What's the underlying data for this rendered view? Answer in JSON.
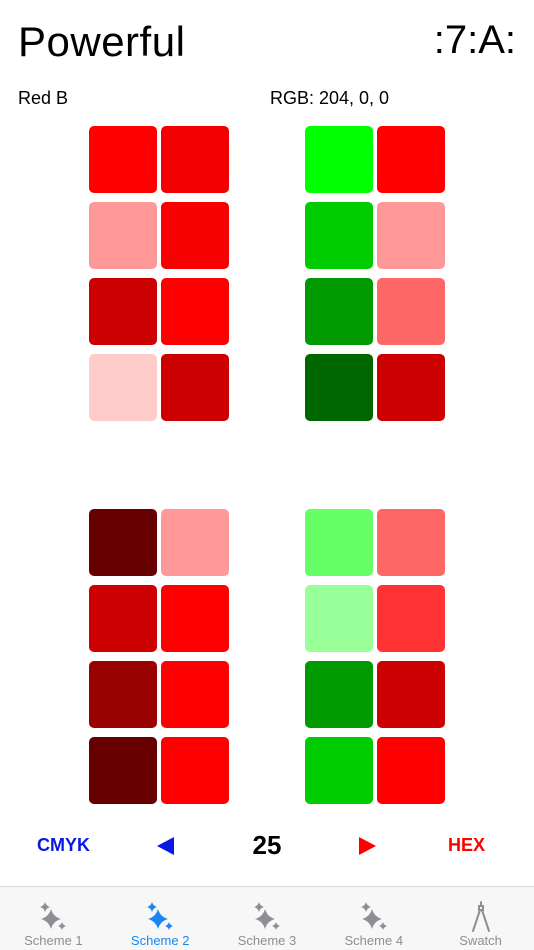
{
  "header": {
    "title": "Powerful",
    "logo": ":7:A:"
  },
  "info": {
    "color_name": "Red B",
    "rgb_text": "RGB: 204, 0, 0"
  },
  "palettes": {
    "top_left": [
      "#ff0000",
      "#f10002",
      "#ff9999",
      "#f60000",
      "#cc0000",
      "#ff0000",
      "#ffcccc",
      "#cc0000"
    ],
    "top_right": [
      "#00ff00",
      "#ff0000",
      "#00cc00",
      "#ff9999",
      "#009900",
      "#ff6666",
      "#006600",
      "#cc0000"
    ],
    "bottom_left": [
      "#660000",
      "#ff9999",
      "#cc0000",
      "#ff0000",
      "#990000",
      "#ff0000",
      "#660000",
      "#ff0000"
    ],
    "bottom_right": [
      "#66ff66",
      "#ff6666",
      "#99ff99",
      "#ff3333",
      "#009900",
      "#cc0000",
      "#00cc00",
      "#ff0000"
    ]
  },
  "controls": {
    "left_label": "CMYK",
    "value": "25",
    "right_label": "HEX",
    "left_color": "#0a18e6",
    "right_color": "#ff0000"
  },
  "tabs": [
    {
      "label": "Scheme 1",
      "icon": "sparkles-icon",
      "active": false
    },
    {
      "label": "Scheme 2",
      "icon": "sparkles-icon",
      "active": true
    },
    {
      "label": "Scheme 3",
      "icon": "sparkles-icon",
      "active": false
    },
    {
      "label": "Scheme 4",
      "icon": "sparkles-icon",
      "active": false
    },
    {
      "label": "Swatch",
      "icon": "compass-icon",
      "active": false
    }
  ]
}
